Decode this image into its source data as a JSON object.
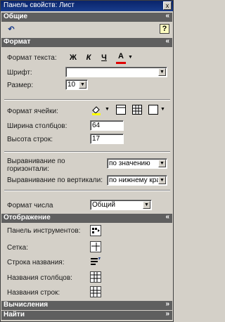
{
  "window": {
    "title": "Панель свойств: Лист",
    "close_glyph": "x"
  },
  "sections": {
    "general": {
      "label": "Общие",
      "chevron": "«"
    },
    "format": {
      "label": "Формат",
      "chevron": "«"
    },
    "display": {
      "label": "Отображение",
      "chevron": "«"
    },
    "calc": {
      "label": "Вычисления",
      "chevron": "»"
    },
    "find": {
      "label": "Найти",
      "chevron": "»"
    }
  },
  "general": {
    "undo_glyph": "↶",
    "help_glyph": "?"
  },
  "format": {
    "text_format_label": "Формат текста:",
    "bold": "Ж",
    "italic": "К",
    "underline": "Ч",
    "font_color": "A",
    "font_label": "Шрифт:",
    "font_value": "",
    "size_label": "Размер:",
    "size_value": "10",
    "cell_format_label": "Формат ячейки:",
    "col_width_label": "Ширина столбцов:",
    "col_width_value": "64",
    "row_height_label": "Высота строк:",
    "row_height_value": "17",
    "halign_label": "Выравнивание по горизонтали:",
    "halign_value": "по значению",
    "valign_label": "Выравнивание по вертикали:",
    "valign_value": "по нижнему кра",
    "number_format_label": "Формат числа",
    "number_format_value": "Общий"
  },
  "display": {
    "toolbar_label": "Панель инструментов:",
    "grid_label": "Сетка:",
    "title_bar_label": "Строка названия:",
    "col_headers_label": "Названия столбцов:",
    "row_headers_label": "Названия строк:"
  },
  "colors": {
    "font_color_bar": "#e00000",
    "title_bg": "#0a246a",
    "section_bg": "#5f5f5f"
  }
}
